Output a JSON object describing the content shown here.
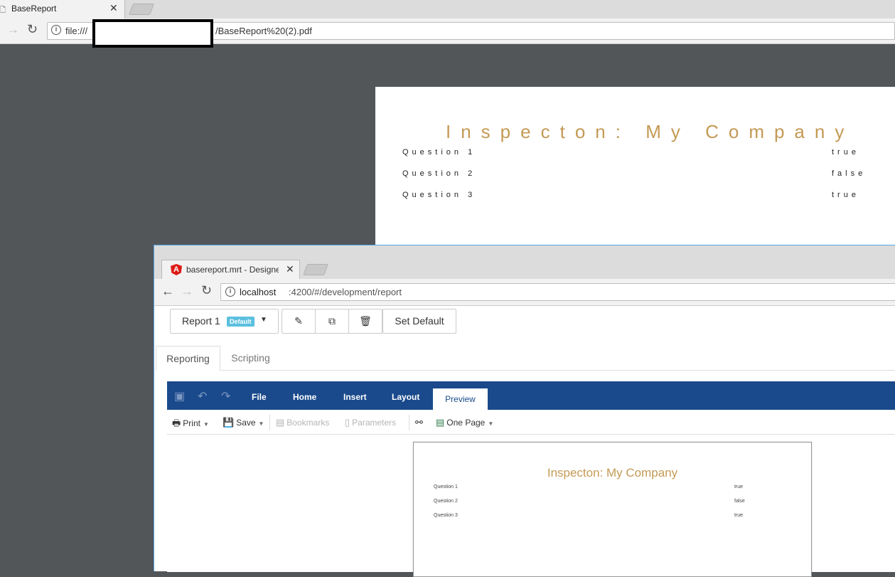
{
  "back_browser": {
    "tab_title": "BaseReport",
    "url_prefix": "file:///",
    "url_suffix": "/BaseReport%20(2).pdf"
  },
  "pdf": {
    "title": "Inspecton: My Company",
    "rows": [
      {
        "question": "Question 1",
        "answer": "true"
      },
      {
        "question": "Question 2",
        "answer": "false"
      },
      {
        "question": "Question 3",
        "answer": "true"
      }
    ]
  },
  "front_browser": {
    "tab_title": "basereport.mrt - Designer",
    "url_host": "localhost",
    "url_path": ":4200/#/development/report"
  },
  "app_toolbar": {
    "report_label": "Report 1",
    "report_badge": "Default",
    "set_default_label": "Set Default"
  },
  "nav_tabs": [
    "Reporting",
    "Scripting"
  ],
  "ribbon": {
    "tabs": [
      "File",
      "Home",
      "Insert",
      "Layout",
      "Preview"
    ],
    "active_tab": "Preview"
  },
  "preview_toolbar": {
    "print": "Print",
    "save": "Save",
    "bookmarks": "Bookmarks",
    "parameters": "Parameters",
    "view_mode": "One Page"
  },
  "preview": {
    "title": "Inspecton: My Company",
    "rows": [
      {
        "question": "Question 1",
        "answer": "true"
      },
      {
        "question": "Question 2",
        "answer": "false"
      },
      {
        "question": "Question 3",
        "answer": "true"
      }
    ]
  },
  "colors": {
    "ribbon": "#1a4a8c",
    "title_gold": "#c49a55",
    "badge": "#5bc0de",
    "pdf_background": "#525659"
  }
}
